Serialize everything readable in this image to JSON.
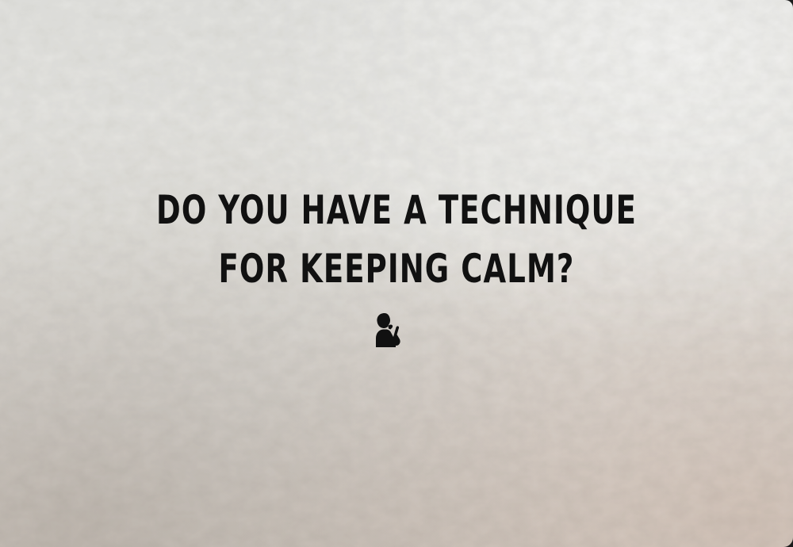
{
  "card": {
    "question_lines": [
      "DO YOU HAVE A TECHNIQUE",
      "FOR KEEPING CALM?"
    ],
    "icon": "thinking-person-icon",
    "paper_color": "#e4e3df",
    "ink_color": "#111111"
  }
}
